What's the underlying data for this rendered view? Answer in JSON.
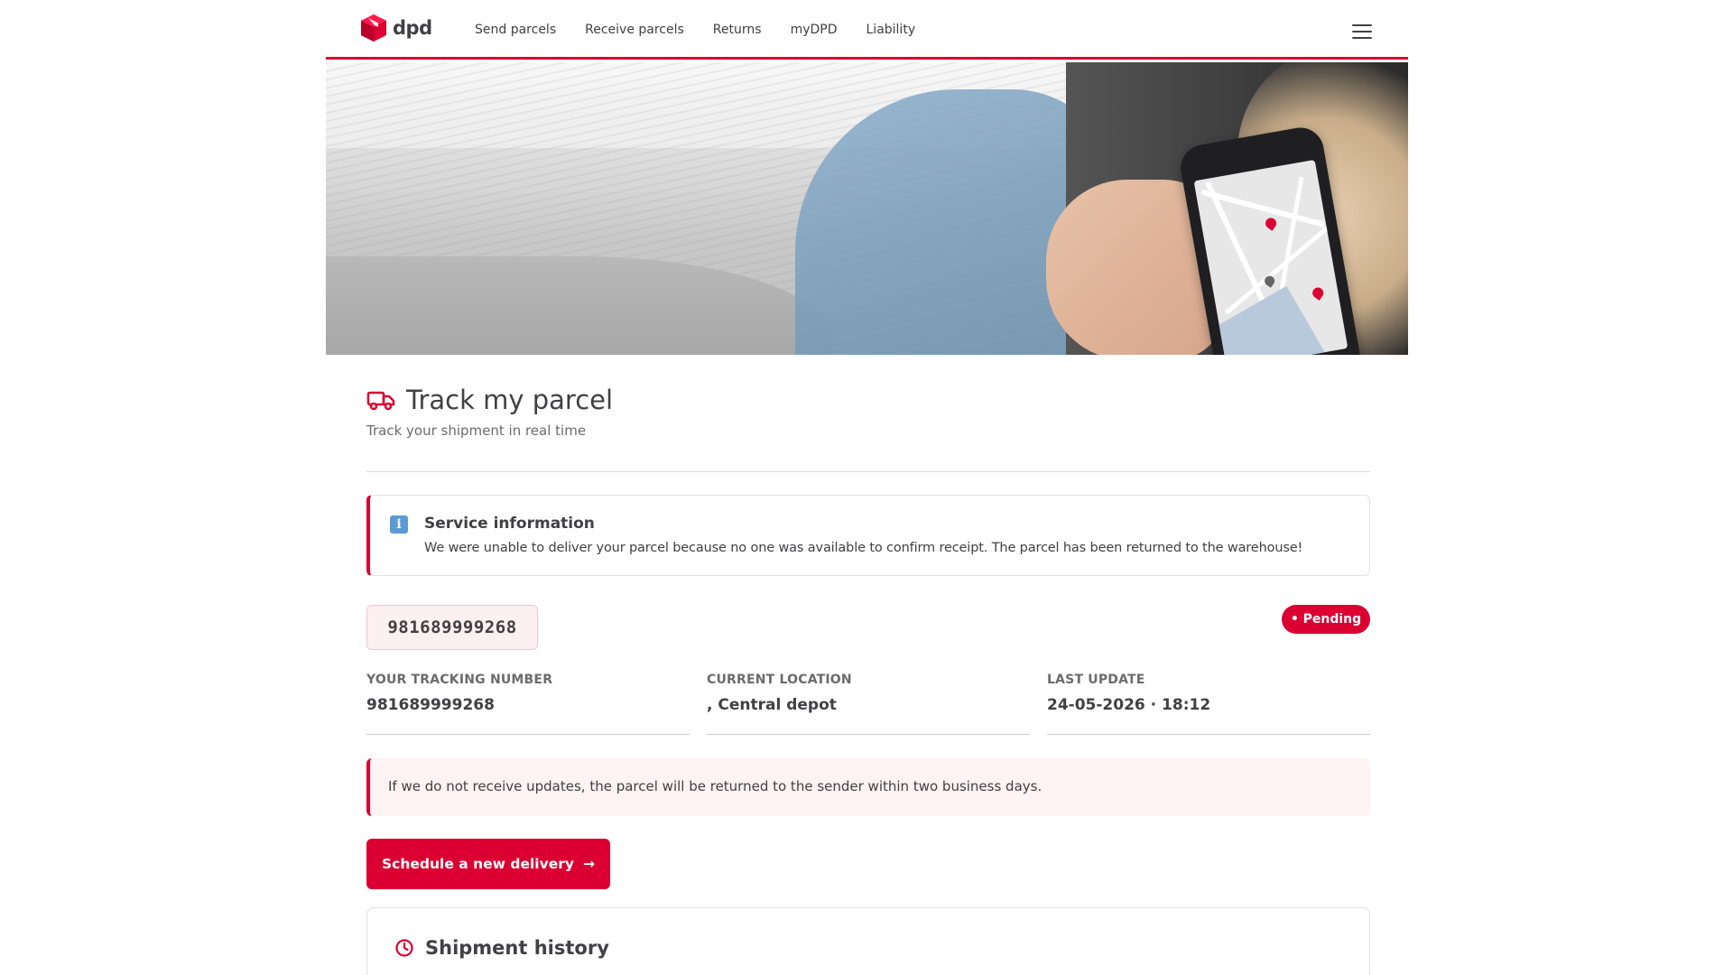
{
  "header": {
    "logo_text": "dpd",
    "nav": [
      "Send parcels",
      "Receive parcels",
      "Returns",
      "myDPD",
      "Liability"
    ]
  },
  "page": {
    "title": "Track my parcel",
    "subtitle": "Track your shipment in real time"
  },
  "service_info": {
    "title": "Service information",
    "text": "We were unable to deliver your parcel because no one was available to confirm receipt. The parcel has been returned to the warehouse!"
  },
  "tracking": {
    "chip_number": "981689999268",
    "status": "• Pending",
    "fields": [
      {
        "label": "Your tracking number",
        "value": "981689999268"
      },
      {
        "label": "Current location",
        "value": ", Central depot"
      },
      {
        "label": "Last update",
        "value": "24-05-2026 · 18:12"
      }
    ]
  },
  "warning": {
    "text": "If we do not receive updates, the parcel will be returned to the sender within two business days."
  },
  "cta": {
    "label": "Schedule a new delivery",
    "arrow": "→"
  },
  "history": {
    "title": "Shipment history"
  },
  "colors": {
    "brand_red": "#dc0032",
    "text": "#414042",
    "info_icon": "#5b9bd5"
  }
}
